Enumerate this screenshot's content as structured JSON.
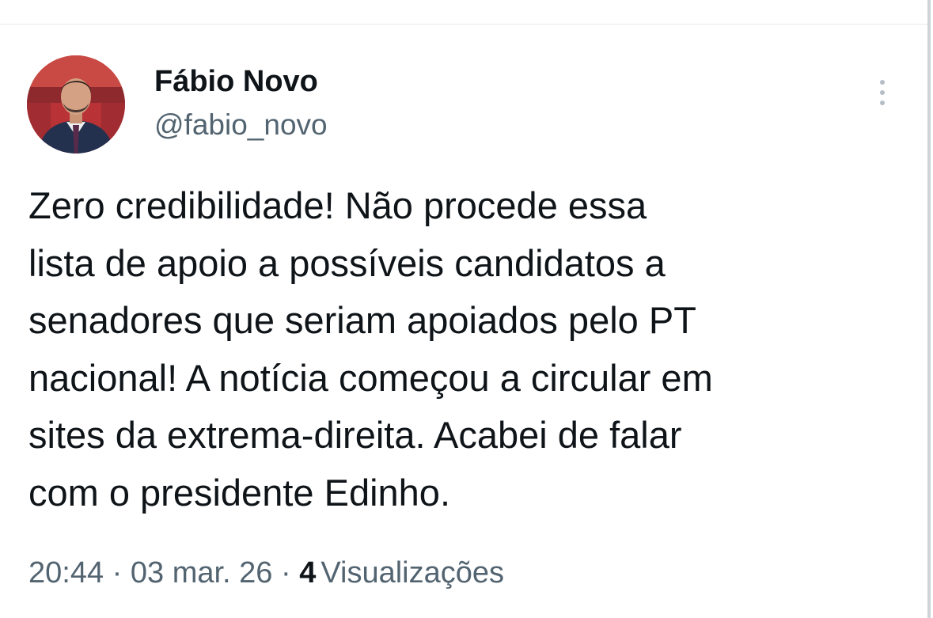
{
  "tweet": {
    "author": {
      "display_name": "Fábio Novo",
      "handle": "@fabio_novo",
      "avatar_icon": "profile-photo"
    },
    "more_icon": "more-vertical-icon",
    "text": "Zero credibilidade! Não procede essa\nlista de apoio a possíveis candidatos a\nsenadores que seriam apoiados pelo PT\nnacional! A notícia começou a circular em\nsites da extrema-direita. Acabei de falar\ncom o presidente Edinho.",
    "meta": {
      "time": "20:44",
      "separator": "·",
      "date": "03 mar. 26",
      "views_count": "4",
      "views_label": "Visualizações"
    }
  },
  "colors": {
    "text_primary": "#0f1419",
    "text_secondary": "#536471",
    "divider": "#e6e9ec"
  }
}
